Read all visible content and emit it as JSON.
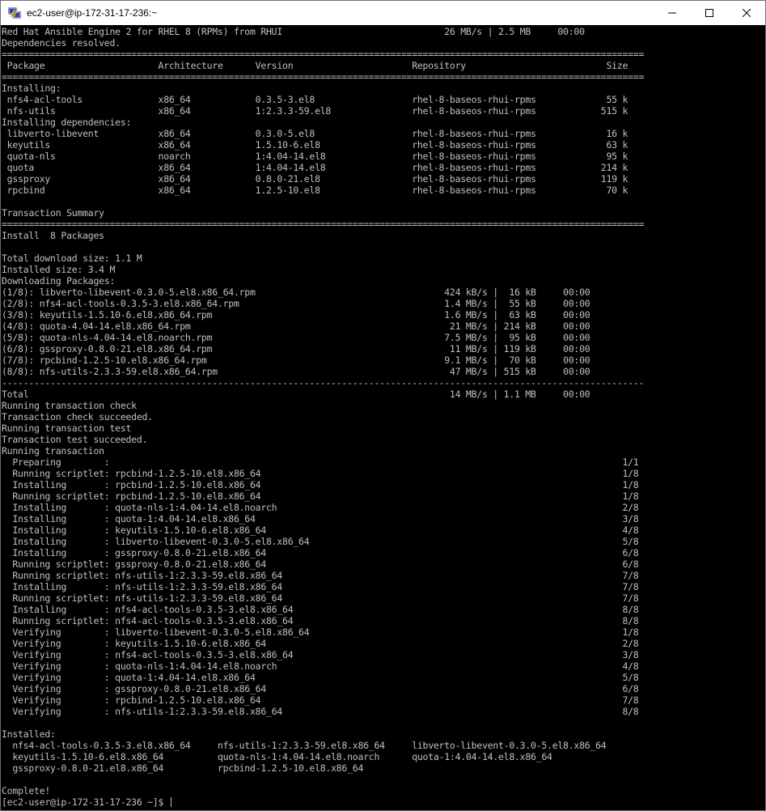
{
  "window": {
    "title": "ec2-user@ip-172-31-17-236:~",
    "controls": {
      "minimize": "─",
      "maximize": "☐",
      "close": "✕"
    },
    "icon": "putty-terminal-icon"
  },
  "terminal": {
    "lines": [
      "Red Hat Ansible Engine 2 for RHEL 8 (RPMs) from RHUI                              26 MB/s | 2.5 MB     00:00",
      "Dependencies resolved.",
      "=======================================================================================================================",
      " Package                     Architecture      Version                      Repository                          Size",
      "=======================================================================================================================",
      "Installing:",
      " nfs4-acl-tools              x86_64            0.3.5-3.el8                  rhel-8-baseos-rhui-rpms             55 k",
      " nfs-utils                   x86_64            1:2.3.3-59.el8               rhel-8-baseos-rhui-rpms            515 k",
      "Installing dependencies:",
      " libverto-libevent           x86_64            0.3.0-5.el8                  rhel-8-baseos-rhui-rpms             16 k",
      " keyutils                    x86_64            1.5.10-6.el8                 rhel-8-baseos-rhui-rpms             63 k",
      " quota-nls                   noarch            1:4.04-14.el8                rhel-8-baseos-rhui-rpms             95 k",
      " quota                       x86_64            1:4.04-14.el8                rhel-8-baseos-rhui-rpms            214 k",
      " gssproxy                    x86_64            0.8.0-21.el8                 rhel-8-baseos-rhui-rpms            119 k",
      " rpcbind                     x86_64            1.2.5-10.el8                 rhel-8-baseos-rhui-rpms             70 k",
      "",
      "Transaction Summary",
      "=======================================================================================================================",
      "Install  8 Packages",
      "",
      "Total download size: 1.1 M",
      "Installed size: 3.4 M",
      "Downloading Packages:",
      "(1/8): libverto-libevent-0.3.0-5.el8.x86_64.rpm                                   424 kB/s |  16 kB     00:00",
      "(2/8): nfs4-acl-tools-0.3.5-3.el8.x86_64.rpm                                      1.4 MB/s |  55 kB     00:00",
      "(3/8): keyutils-1.5.10-6.el8.x86_64.rpm                                           1.6 MB/s |  63 kB     00:00",
      "(4/8): quota-4.04-14.el8.x86_64.rpm                                                21 MB/s | 214 kB     00:00",
      "(5/8): quota-nls-4.04-14.el8.noarch.rpm                                           7.5 MB/s |  95 kB     00:00",
      "(6/8): gssproxy-0.8.0-21.el8.x86_64.rpm                                            11 MB/s | 119 kB     00:00",
      "(7/8): rpcbind-1.2.5-10.el8.x86_64.rpm                                            9.1 MB/s |  70 kB     00:00",
      "(8/8): nfs-utils-2.3.3-59.el8.x86_64.rpm                                           47 MB/s | 515 kB     00:00",
      "-----------------------------------------------------------------------------------------------------------------------",
      "Total                                                                              14 MB/s | 1.1 MB     00:00",
      "Running transaction check",
      "Transaction check succeeded.",
      "Running transaction test",
      "Transaction test succeeded.",
      "Running transaction",
      "  Preparing        :                                                                                               1/1",
      "  Running scriptlet: rpcbind-1.2.5-10.el8.x86_64                                                                   1/8",
      "  Installing       : rpcbind-1.2.5-10.el8.x86_64                                                                   1/8",
      "  Running scriptlet: rpcbind-1.2.5-10.el8.x86_64                                                                   1/8",
      "  Installing       : quota-nls-1:4.04-14.el8.noarch                                                                2/8",
      "  Installing       : quota-1:4.04-14.el8.x86_64                                                                    3/8",
      "  Installing       : keyutils-1.5.10-6.el8.x86_64                                                                  4/8",
      "  Installing       : libverto-libevent-0.3.0-5.el8.x86_64                                                          5/8",
      "  Installing       : gssproxy-0.8.0-21.el8.x86_64                                                                  6/8",
      "  Running scriptlet: gssproxy-0.8.0-21.el8.x86_64                                                                  6/8",
      "  Running scriptlet: nfs-utils-1:2.3.3-59.el8.x86_64                                                               7/8",
      "  Installing       : nfs-utils-1:2.3.3-59.el8.x86_64                                                               7/8",
      "  Running scriptlet: nfs-utils-1:2.3.3-59.el8.x86_64                                                               7/8",
      "  Installing       : nfs4-acl-tools-0.3.5-3.el8.x86_64                                                             8/8",
      "  Running scriptlet: nfs4-acl-tools-0.3.5-3.el8.x86_64                                                             8/8",
      "  Verifying        : libverto-libevent-0.3.0-5.el8.x86_64                                                          1/8",
      "  Verifying        : keyutils-1.5.10-6.el8.x86_64                                                                  2/8",
      "  Verifying        : nfs4-acl-tools-0.3.5-3.el8.x86_64                                                             3/8",
      "  Verifying        : quota-nls-1:4.04-14.el8.noarch                                                                4/8",
      "  Verifying        : quota-1:4.04-14.el8.x86_64                                                                    5/8",
      "  Verifying        : gssproxy-0.8.0-21.el8.x86_64                                                                  6/8",
      "  Verifying        : rpcbind-1.2.5-10.el8.x86_64                                                                   7/8",
      "  Verifying        : nfs-utils-1:2.3.3-59.el8.x86_64                                                               8/8",
      "",
      "Installed:",
      "  nfs4-acl-tools-0.3.5-3.el8.x86_64     nfs-utils-1:2.3.3-59.el8.x86_64     libverto-libevent-0.3.0-5.el8.x86_64",
      "  keyutils-1.5.10-6.el8.x86_64          quota-nls-1:4.04-14.el8.noarch      quota-1:4.04-14.el8.x86_64",
      "  gssproxy-0.8.0-21.el8.x86_64          rpcbind-1.2.5-10.el8.x86_64",
      "",
      "Complete!"
    ],
    "prompt": "[ec2-user@ip-172-31-17-236 ~]$ "
  },
  "colors": {
    "terminal_bg": "#000000",
    "terminal_fg": "#c0c0c0",
    "titlebar_bg": "#ffffff"
  }
}
